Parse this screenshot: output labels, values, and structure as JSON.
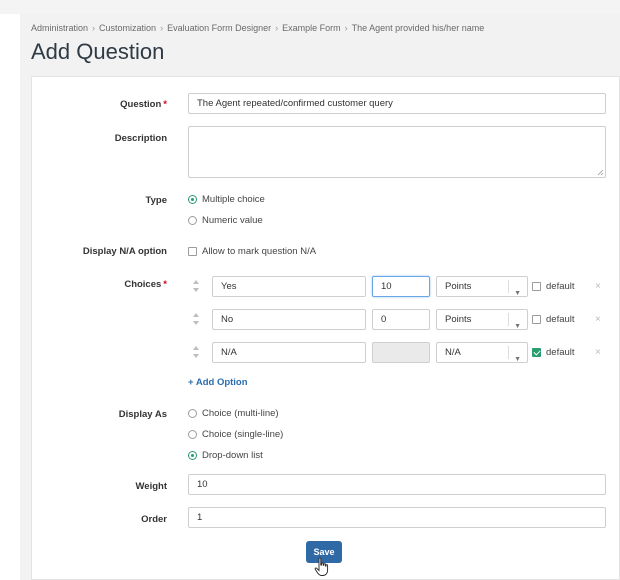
{
  "breadcrumb": [
    "Administration",
    "Customization",
    "Evaluation Form Designer",
    "Example Form",
    "The Agent provided his/her name"
  ],
  "page_title": "Add Question",
  "form": {
    "question": {
      "label": "Question",
      "required_marker": "*",
      "value": "The Agent repeated/confirmed customer query"
    },
    "description": {
      "label": "Description",
      "value": ""
    },
    "type": {
      "label": "Type",
      "options": [
        "Multiple choice",
        "Numeric value"
      ],
      "selected": "Multiple choice"
    },
    "na_option": {
      "label": "Display N/A option",
      "checkbox_label": "Allow to mark question N/A",
      "checked": false
    },
    "choices": {
      "label": "Choices",
      "required_marker": "*",
      "rows": [
        {
          "name": "Yes",
          "value": "10",
          "unit": "Points",
          "default_label": "default",
          "default": false
        },
        {
          "name": "No",
          "value": "0",
          "unit": "Points",
          "default_label": "default",
          "default": false
        },
        {
          "name": "N/A",
          "value": "",
          "unit": "N/A",
          "default_label": "default",
          "default": true
        }
      ],
      "add_option": "+ Add Option"
    },
    "display_as": {
      "label": "Display As",
      "options": [
        "Choice (multi-line)",
        "Choice (single-line)",
        "Drop-down list"
      ],
      "selected": "Drop-down list"
    },
    "weight": {
      "label": "Weight",
      "value": "10"
    },
    "order": {
      "label": "Order",
      "value": "1"
    },
    "save_label": "Save"
  },
  "colors": {
    "accent_green": "#2a9d6f",
    "button_blue": "#2f6aa7",
    "link_blue": "#2b6cb0",
    "required_red": "#d0021b"
  }
}
